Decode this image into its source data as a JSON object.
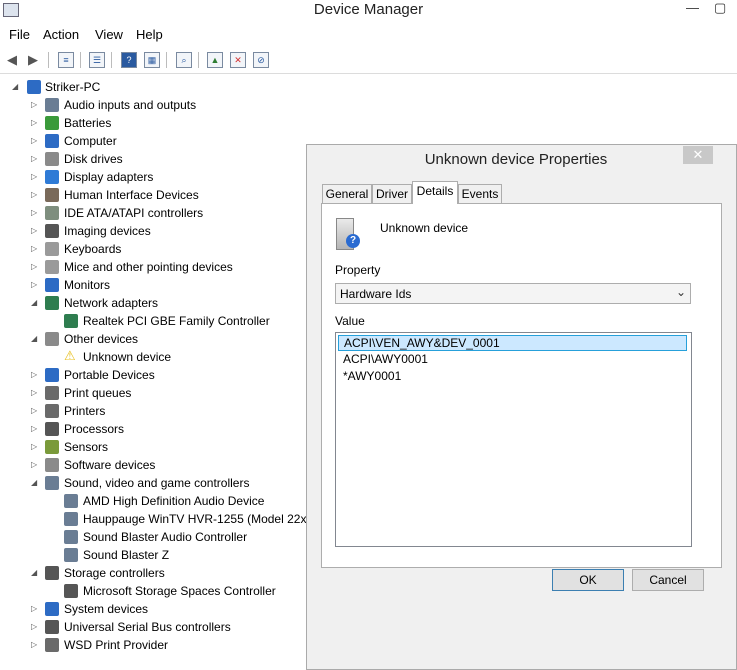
{
  "window": {
    "title": "Device Manager",
    "minimize": "—",
    "maximize": "▢"
  },
  "menu": {
    "file": "File",
    "action": "Action",
    "view": "View",
    "help": "Help"
  },
  "tree": {
    "root": "Striker-PC",
    "items": [
      {
        "label": "Audio inputs and outputs",
        "icon": "speaker-icon",
        "color": "#6a7d94"
      },
      {
        "label": "Batteries",
        "icon": "battery-icon",
        "color": "#3a9a3a"
      },
      {
        "label": "Computer",
        "icon": "computer-icon",
        "color": "#2d6bc4"
      },
      {
        "label": "Disk drives",
        "icon": "disk-drive-icon",
        "color": "#8a8a8a"
      },
      {
        "label": "Display adapters",
        "icon": "display-adapter-icon",
        "color": "#2f7bd6"
      },
      {
        "label": "Human Interface Devices",
        "icon": "hid-icon",
        "color": "#7a6a5a"
      },
      {
        "label": "IDE ATA/ATAPI controllers",
        "icon": "ide-controller-icon",
        "color": "#7e8e7e"
      },
      {
        "label": "Imaging devices",
        "icon": "camera-icon",
        "color": "#555555"
      },
      {
        "label": "Keyboards",
        "icon": "keyboard-icon",
        "color": "#9a9a9a"
      },
      {
        "label": "Mice and other pointing devices",
        "icon": "mouse-icon",
        "color": "#9a9a9a"
      },
      {
        "label": "Monitors",
        "icon": "monitor-icon",
        "color": "#2d6bc4"
      },
      {
        "label": "Network adapters",
        "icon": "network-icon",
        "color": "#2e7d4f"
      },
      {
        "label": "Realtek PCI GBE Family Controller",
        "icon": "network-icon",
        "color": "#2e7d4f",
        "child": true
      },
      {
        "label": "Other devices",
        "icon": "other-devices-icon",
        "color": "#8a8a8a"
      },
      {
        "label": "Unknown device",
        "icon": "warning-icon",
        "color": "#e8c020",
        "child": true
      },
      {
        "label": "Portable Devices",
        "icon": "portable-device-icon",
        "color": "#2d6bc4"
      },
      {
        "label": "Print queues",
        "icon": "printer-icon",
        "color": "#6a6a6a"
      },
      {
        "label": "Printers",
        "icon": "printer-icon",
        "color": "#6a6a6a"
      },
      {
        "label": "Processors",
        "icon": "processor-icon",
        "color": "#555555"
      },
      {
        "label": "Sensors",
        "icon": "sensor-icon",
        "color": "#7a9a3a"
      },
      {
        "label": "Software devices",
        "icon": "software-device-icon",
        "color": "#8a8a8a"
      },
      {
        "label": "Sound, video and game controllers",
        "icon": "speaker-icon",
        "color": "#6a7d94"
      },
      {
        "label": "AMD High Definition Audio Device",
        "icon": "speaker-icon",
        "color": "#6a7d94",
        "child": true
      },
      {
        "label": "Hauppauge WinTV HVR-1255 (Model 22xx",
        "icon": "speaker-icon",
        "color": "#6a7d94",
        "child": true
      },
      {
        "label": "Sound Blaster Audio Controller",
        "icon": "speaker-icon",
        "color": "#6a7d94",
        "child": true
      },
      {
        "label": "Sound Blaster Z",
        "icon": "speaker-icon",
        "color": "#6a7d94",
        "child": true
      },
      {
        "label": "Storage controllers",
        "icon": "storage-controller-icon",
        "color": "#555555"
      },
      {
        "label": "Microsoft Storage Spaces Controller",
        "icon": "storage-controller-icon",
        "color": "#555555",
        "child": true
      },
      {
        "label": "System devices",
        "icon": "system-device-icon",
        "color": "#2d6bc4"
      },
      {
        "label": "Universal Serial Bus controllers",
        "icon": "usb-icon",
        "color": "#555555"
      },
      {
        "label": "WSD Print Provider",
        "icon": "printer-icon",
        "color": "#6a6a6a"
      }
    ]
  },
  "dialog": {
    "title": "Unknown device Properties",
    "close": "✕",
    "tabs": [
      "General",
      "Driver",
      "Details",
      "Events"
    ],
    "active_tab": "Details",
    "device_name": "Unknown device",
    "property_label": "Property",
    "property_value": "Hardware Ids",
    "value_label": "Value",
    "values": [
      "ACPI\\VEN_AWY&DEV_0001",
      "ACPI\\AWY0001",
      "*AWY0001"
    ],
    "ok": "OK",
    "cancel": "Cancel"
  }
}
